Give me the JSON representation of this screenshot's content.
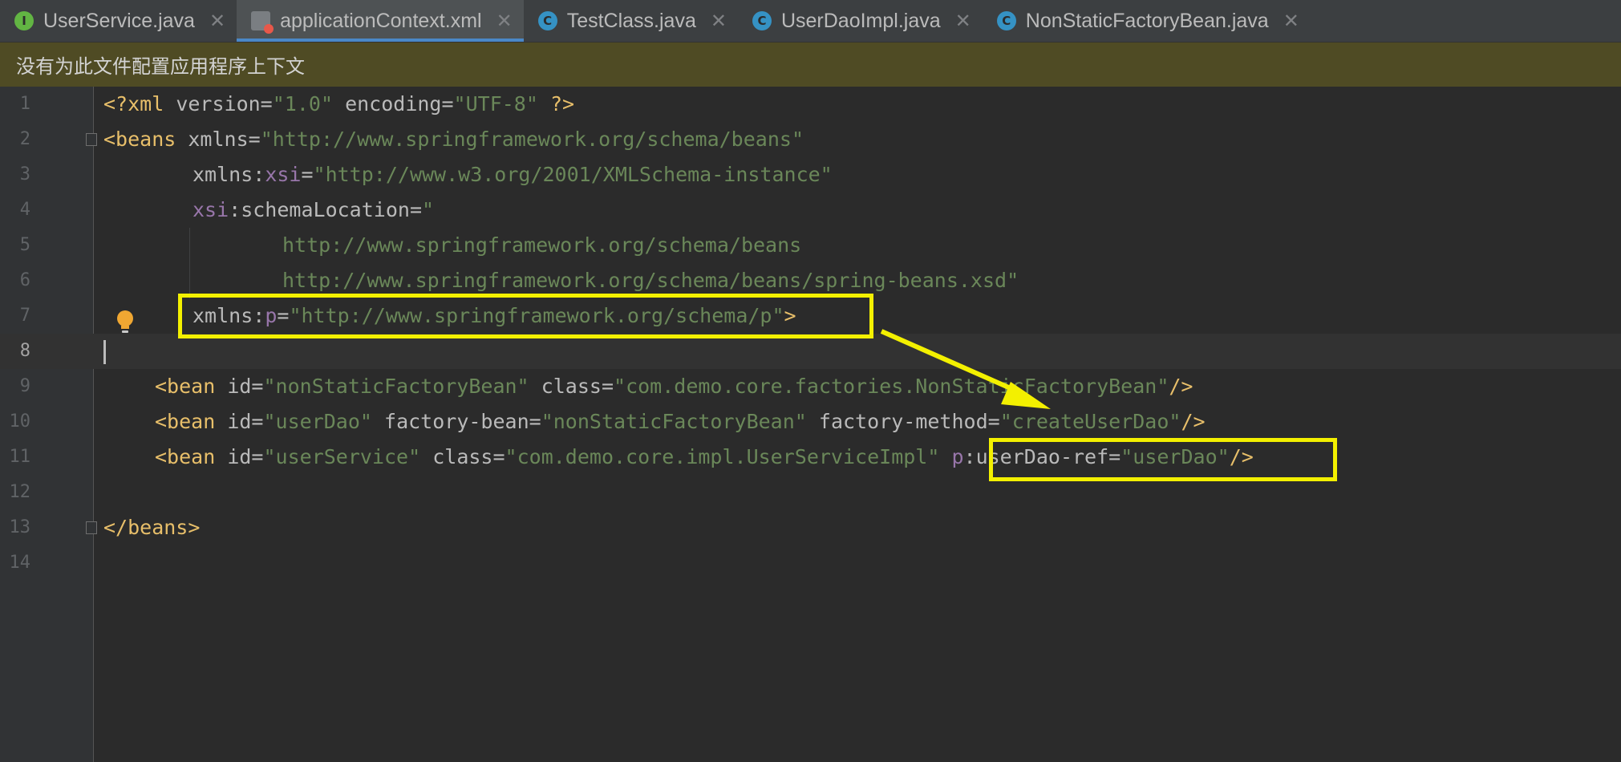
{
  "tabs": [
    {
      "label": "UserService.java",
      "icon": "interface-icon",
      "active": false
    },
    {
      "label": "applicationContext.xml",
      "icon": "xml-file-icon",
      "active": true
    },
    {
      "label": "TestClass.java",
      "icon": "class-run-icon",
      "active": false
    },
    {
      "label": "UserDaoImpl.java",
      "icon": "class-icon",
      "active": false
    },
    {
      "label": "NonStaticFactoryBean.java",
      "icon": "class-icon",
      "active": false
    }
  ],
  "banner": {
    "text": "没有为此文件配置应用程序上下文"
  },
  "editor": {
    "current_line": 8,
    "lines": [
      {
        "n": "1"
      },
      {
        "n": "2"
      },
      {
        "n": "3"
      },
      {
        "n": "4"
      },
      {
        "n": "5"
      },
      {
        "n": "6"
      },
      {
        "n": "7"
      },
      {
        "n": "8"
      },
      {
        "n": "9"
      },
      {
        "n": "10"
      },
      {
        "n": "11"
      },
      {
        "n": "12"
      },
      {
        "n": "13"
      },
      {
        "n": "14"
      }
    ],
    "code": {
      "l1": {
        "open": "<?xml ",
        "a1": "version",
        "eq1": "=",
        "v1": "\"1.0\"",
        "sp": " ",
        "a2": "encoding",
        "eq2": "=",
        "v2": "\"UTF-8\"",
        "close": " ?>"
      },
      "l2": {
        "open": "<beans ",
        "a1": "xmlns",
        "eq": "=",
        "v": "\"http://www.springframework.org/schema/beans\""
      },
      "l3": {
        "a1": "xmlns:",
        "ns": "xsi",
        "eq": "=",
        "v": "\"http://www.w3.org/2001/XMLSchema-instance\""
      },
      "l4": {
        "ns": "xsi",
        "a1": ":schemaLocation",
        "eq": "=",
        "v": "\""
      },
      "l5": {
        "v": "http://www.springframework.org/schema/beans"
      },
      "l6": {
        "v": "http://www.springframework.org/schema/beans/spring-beans.xsd\""
      },
      "l7": {
        "a1": "xmlns:",
        "ns": "p",
        "eq": "=",
        "v": "\"http://www.springframework.org/schema/p\"",
        "close": ">"
      },
      "l9": {
        "open": "<bean ",
        "a1": "id",
        "eq1": "=",
        "v1": "\"nonStaticFactoryBean\"",
        "sp": " ",
        "a2": "class",
        "eq2": "=",
        "v2": "\"com.demo.core.factories.NonStaticFactoryBean\"",
        "close": "/>"
      },
      "l10": {
        "open": "<bean ",
        "a1": "id",
        "eq1": "=",
        "v1": "\"userDao\"",
        "sp1": " ",
        "a2": "factory-bean",
        "eq2": "=",
        "v2": "\"nonStaticFactoryBean\"",
        "sp2": " ",
        "a3": "factory-method",
        "eq3": "=",
        "v3": "\"createUserDao\"",
        "close": "/>"
      },
      "l11": {
        "open": "<bean ",
        "a1": "id",
        "eq1": "=",
        "v1": "\"userService\"",
        "sp1": " ",
        "a2": "class",
        "eq2": "=",
        "v2": "\"com.demo.core.impl.UserServiceImpl\"",
        "sp2": " ",
        "ns": "p",
        "a3": ":userDao-ref",
        "eq3": "=",
        "v3": "\"userDao\"",
        "close": "/>"
      },
      "l13": {
        "close": "</beans>"
      }
    }
  },
  "colors": {
    "annotation": "#f3f000",
    "tag": "#e8bf6a",
    "attribute": "#bababa",
    "namespace": "#9876aa",
    "string": "#6a8759",
    "banner_bg": "#4f4b24"
  }
}
